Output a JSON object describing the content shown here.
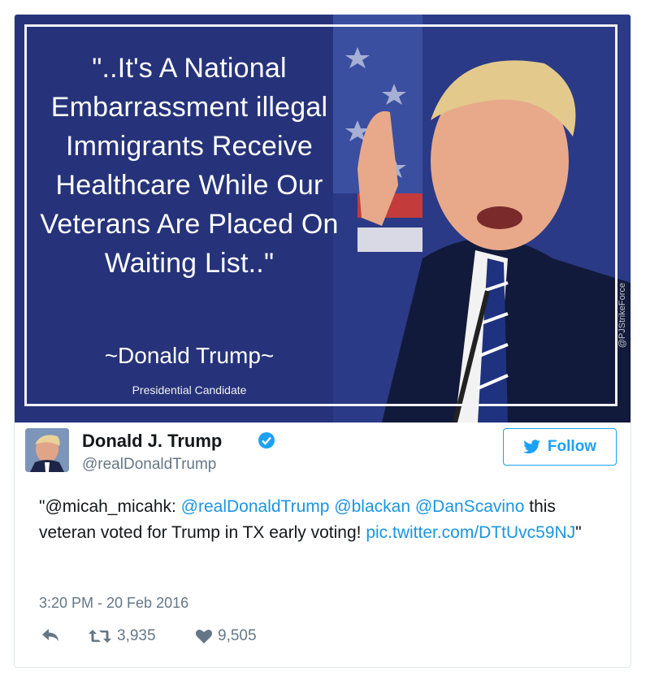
{
  "image": {
    "quote": "\"..It's A National Embarrassment illegal Immigrants Receive Healthcare While Our Veterans Are Placed On Waiting List..\"",
    "attribution": "~Donald Trump~",
    "subtitle": "Presidential Candidate",
    "watermark": "@PJStrikeForce"
  },
  "tweet": {
    "display_name": "Donald J. Trump",
    "handle": "@realDonaldTrump",
    "follow_label": "Follow",
    "text_prefix": "\"",
    "mention_1": "@micah_micahk",
    "sep_1": ": ",
    "mention_2": "@realDonaldTrump",
    "mention_3": "@blackan",
    "mention_4": "@DanScavino",
    "text_body": " this veteran voted for Trump in TX early voting! ",
    "pic_link": "pic.twitter.com/DTtUvc59NJ",
    "text_suffix": "\"",
    "timestamp": "3:20 PM - 20 Feb 2016",
    "retweets": "3,935",
    "likes": "9,505"
  },
  "colors": {
    "background_blue": "#26337a",
    "link_blue": "#1b95e0",
    "follow_blue": "#1da1f2",
    "muted_gray": "#657786"
  },
  "icons": [
    "verified-badge-icon",
    "twitter-bird-icon",
    "reply-icon",
    "retweet-icon",
    "heart-icon"
  ]
}
